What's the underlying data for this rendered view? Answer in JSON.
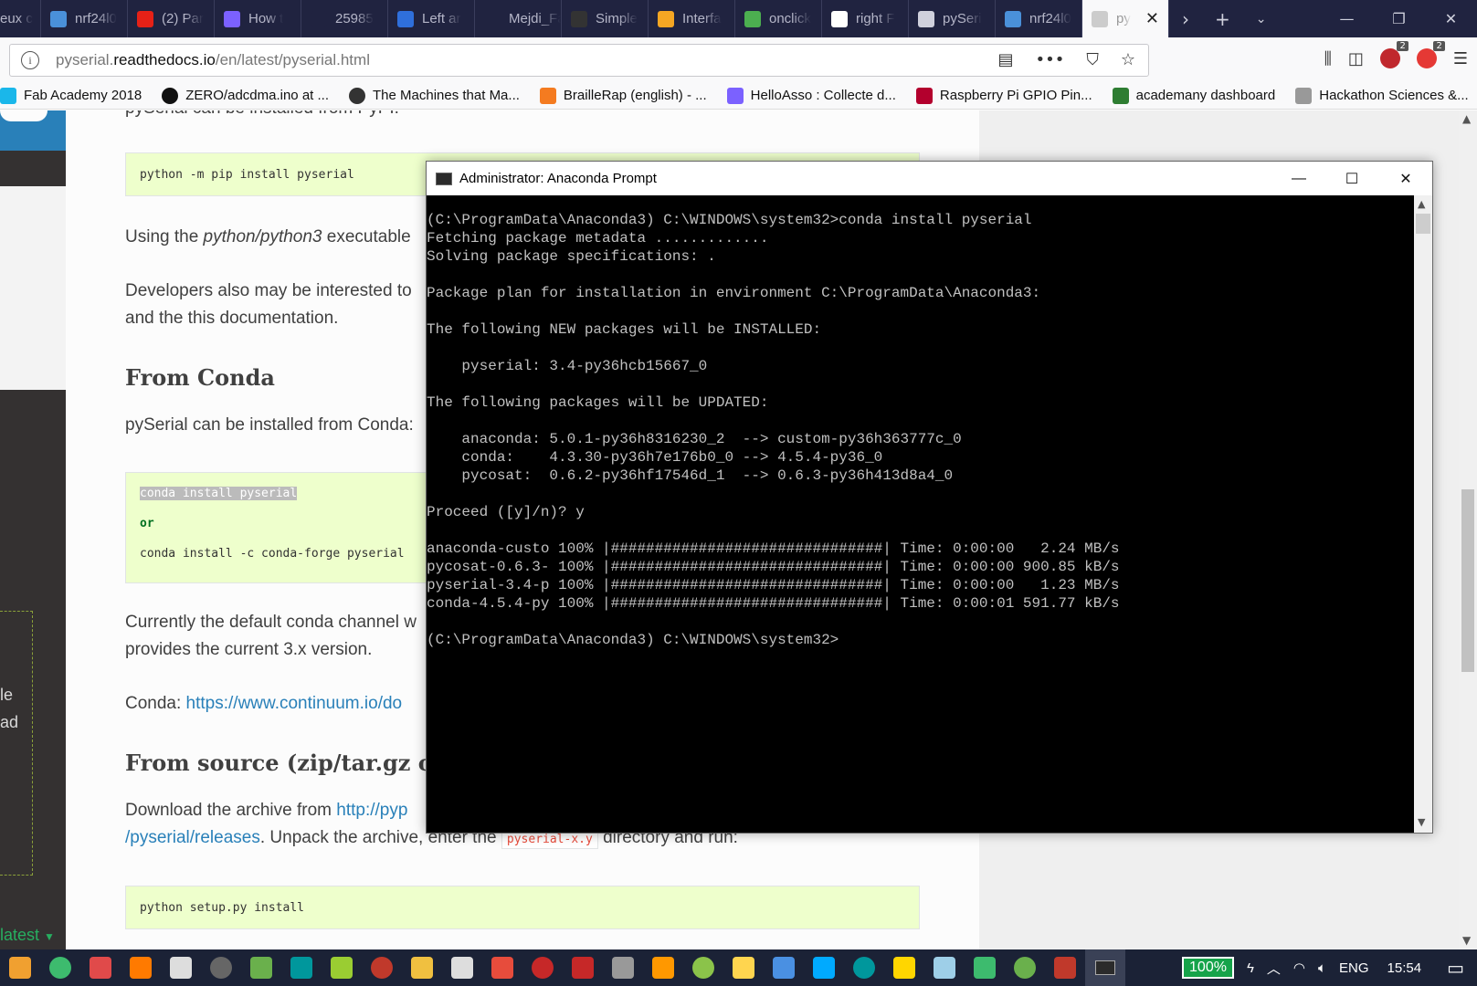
{
  "browser": {
    "tabs": [
      {
        "label": "eux c",
        "favicon": "page-icon",
        "color": "#202340"
      },
      {
        "label": "nrf24l0",
        "favicon": "arduino-icon",
        "color": "#4a90d9"
      },
      {
        "label": "(2) Par",
        "favicon": "youtube-icon",
        "color": "#e62117"
      },
      {
        "label": "How t",
        "favicon": "play-icon",
        "color": "#7b61ff"
      },
      {
        "label": "25985",
        "favicon": "back-icon",
        "color": "#202340"
      },
      {
        "label": "Left ar",
        "favicon": "bird-icon",
        "color": "#2f6fdb"
      },
      {
        "label": "Mejdi_Fab",
        "favicon": "none",
        "color": "#202340"
      },
      {
        "label": "Simple",
        "favicon": "github-icon",
        "color": "#333"
      },
      {
        "label": "Interfa",
        "favicon": "robot-icon",
        "color": "#f5a623"
      },
      {
        "label": "onclick",
        "favicon": "w3-icon",
        "color": "#4caf50"
      },
      {
        "label": "right F",
        "favicon": "google-icon",
        "color": "#fff"
      },
      {
        "label": "pySeri",
        "favicon": "reader-icon",
        "color": "#cfd0dc"
      },
      {
        "label": "nrf24l0",
        "favicon": "arduino-icon",
        "color": "#4a90d9"
      }
    ],
    "active_tab": {
      "label": "py",
      "close": "✕"
    },
    "url_host_prefix": "pyserial.",
    "url_host": "readthedocs.io",
    "url_path": "/en/latest/pyserial.html",
    "bookmarks": [
      {
        "label": "Fab Academy 2018",
        "color": "#1ab7ea"
      },
      {
        "label": "ZERO/adcdma.ino at ...",
        "color": "#111"
      },
      {
        "label": "The Machines that Ma...",
        "color": "#333"
      },
      {
        "label": "BrailleRap (english) - ...",
        "color": "#f47b20"
      },
      {
        "label": "HelloAsso : Collecte d...",
        "color": "#7b61ff"
      },
      {
        "label": "Raspberry Pi GPIO Pin...",
        "color": "#b3002d"
      },
      {
        "label": "academany dashboard",
        "color": "#2e7d32"
      },
      {
        "label": "Hackathon Sciences &...",
        "color": "#999"
      }
    ],
    "badge1": "2",
    "badge2": "2"
  },
  "sidebar": {
    "text1": "le",
    "text2": "ad",
    "version": "latest"
  },
  "doc": {
    "pypi_partial": "pySerial can be installed from PyPI:",
    "pip_cmd": "python -m pip install pyserial",
    "using_pre": "Using the ",
    "using_em": "python/python3",
    "using_post": " executable",
    "dev_line1": "Developers also may be interested to",
    "dev_line2": "and the this documentation.",
    "h_conda": "From Conda",
    "conda_intro": "pySerial can be installed from Conda:",
    "conda_cmd1": "conda install pyserial",
    "conda_or": "or",
    "conda_cmd2": "conda install -c conda-forge pyserial",
    "current_line1": "Currently the default conda channel w",
    "current_line2": "provides the current 3.x version.",
    "conda_label": "Conda: ",
    "conda_link": "https://www.continuum.io/do",
    "h_source": "From source (zip/tar.gz or cl",
    "download_pre": "Download the archive from ",
    "download_link": "http://pyp",
    "releases_link": "/pyserial/releases",
    "unpack_text": ". Unpack the archive, enter the ",
    "unpack_code": "pyserial-x.y",
    "unpack_post": " directory and run:",
    "setup_cmd": "python setup.py install"
  },
  "console": {
    "title": "Administrator: Anaconda Prompt",
    "lines": [
      "(C:\\ProgramData\\Anaconda3) C:\\WINDOWS\\system32>conda install pyserial",
      "Fetching package metadata .............",
      "Solving package specifications: .",
      "",
      "Package plan for installation in environment C:\\ProgramData\\Anaconda3:",
      "",
      "The following NEW packages will be INSTALLED:",
      "",
      "    pyserial: 3.4-py36hcb15667_0",
      "",
      "The following packages will be UPDATED:",
      "",
      "    anaconda: 5.0.1-py36h8316230_2  --> custom-py36h363777c_0",
      "    conda:    4.3.30-py36h7e176b0_0 --> 4.5.4-py36_0",
      "    pycosat:  0.6.2-py36hf17546d_1  --> 0.6.3-py36h413d8a4_0",
      "",
      "Proceed ([y]/n)? y",
      "",
      "anaconda-custo 100% |###############################| Time: 0:00:00   2.24 MB/s",
      "pycosat-0.6.3- 100% |###############################| Time: 0:00:00 900.85 kB/s",
      "pyserial-3.4-p 100% |###############################| Time: 0:00:00   1.23 MB/s",
      "conda-4.5.4-py 100% |###############################| Time: 0:00:01 591.77 kB/s",
      "",
      "(C:\\ProgramData\\Anaconda3) C:\\WINDOWS\\system32>"
    ]
  },
  "taskbar": {
    "icon_colors": [
      "#f0a030",
      "#3dbb6e",
      "#e04a4a",
      "#ff7a00",
      "#ddd",
      "#666",
      "#6ab04c",
      "#00979c",
      "#9acd32",
      "#c0392b",
      "#f0c040",
      "#ddd",
      "#e74c3c",
      "#c62828",
      "#c62828",
      "#999",
      "#ff9800",
      "#8bc34a",
      "#ffd54f",
      "#4a90e2",
      "#00aaff",
      "#00979c",
      "#ffd600",
      "#9ecfe8",
      "#3dbb6e",
      "#6ab04c",
      "#c0392b"
    ],
    "battery": "100%",
    "lang": "ENG",
    "time": "15:54"
  }
}
